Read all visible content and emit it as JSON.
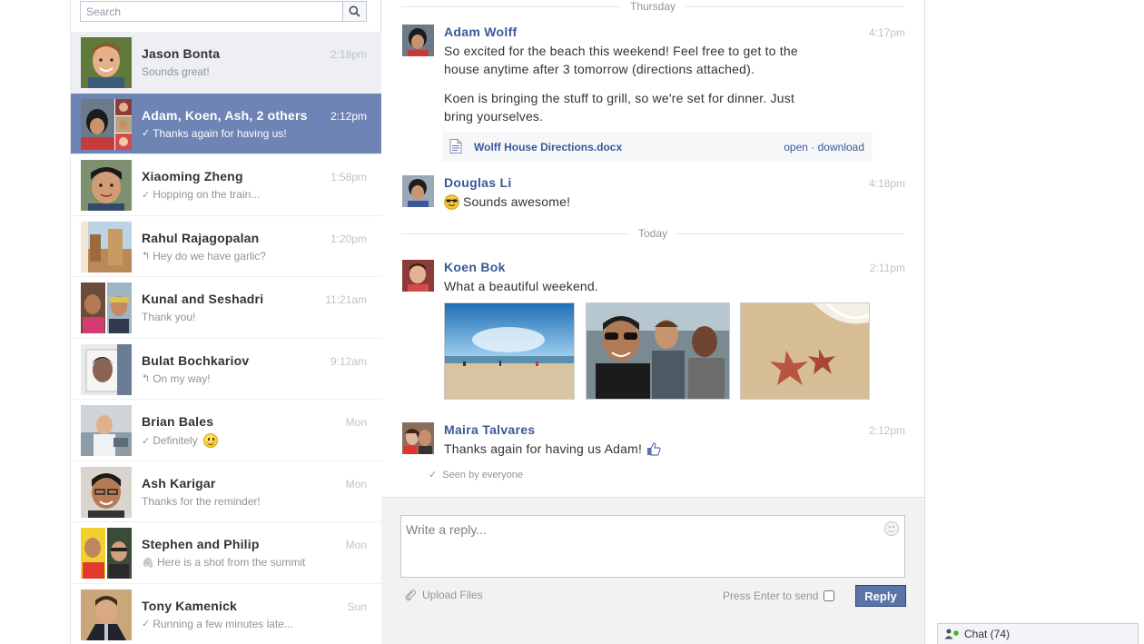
{
  "search": {
    "placeholder": "Search"
  },
  "threads": [
    {
      "name": "Jason Bonta",
      "time": "2:18pm",
      "snippet": "Sounds great!",
      "mark": ""
    },
    {
      "name": "Adam, Koen, Ash, 2 others",
      "time": "2:12pm",
      "snippet": "Thanks again for having us!",
      "mark": "✓"
    },
    {
      "name": "Xiaoming Zheng",
      "time": "1:58pm",
      "snippet": "Hopping on the train...",
      "mark": "✓"
    },
    {
      "name": "Rahul Rajagopalan",
      "time": "1:20pm",
      "snippet": "Hey do we have garlic?",
      "mark": "↰"
    },
    {
      "name": "Kunal and Seshadri",
      "time": "11:21am",
      "snippet": "Thank you!",
      "mark": ""
    },
    {
      "name": "Bulat Bochkariov",
      "time": "9:12am",
      "snippet": "On my way!",
      "mark": "↰"
    },
    {
      "name": "Brian Bales",
      "time": "Mon",
      "snippet": "Definitely",
      "mark": "✓"
    },
    {
      "name": "Ash Karigar",
      "time": "Mon",
      "snippet": "Thanks for the reminder!",
      "mark": ""
    },
    {
      "name": "Stephen and Philip",
      "time": "Mon",
      "snippet": "Here is a shot from the summit",
      "mark": "⌕"
    },
    {
      "name": "Tony Kamenick",
      "time": "Sun",
      "snippet": "Running a few minutes late...",
      "mark": "✓"
    }
  ],
  "conversation": {
    "divider_thursday": "Thursday",
    "divider_today": "Today",
    "messages": [
      {
        "name": "Adam Wolff",
        "time": "4:17pm",
        "text1": "So excited for the beach this weekend! Feel free to get to the",
        "text2": "house anytime after 3 tomorrow (directions attached).",
        "text3": "Koen is bringing the stuff to grill, so we're set for dinner. Just",
        "text4": "bring yourselves."
      },
      {
        "name": "Douglas Li",
        "time": "4:18pm",
        "text1": "Sounds awesome!"
      },
      {
        "name": "Koen Bok",
        "time": "2:11pm",
        "text1": "What a beautiful weekend."
      },
      {
        "name": "Maira Talvares",
        "time": "2:12pm",
        "text1": "Thanks again for having us Adam!"
      }
    ],
    "attachment": {
      "filename": "Wolff House Directions.docx",
      "open": "open",
      "separator": " · ",
      "download": "download"
    },
    "seen": "Seen by everyone"
  },
  "composer": {
    "placeholder": "Write a reply...",
    "upload_label": "Upload Files",
    "enter_label": "Press Enter to send",
    "reply_label": "Reply"
  },
  "chat_bar": {
    "label": "Chat (74)"
  },
  "colors": {
    "brand_blue": "#3b5998",
    "selected_row": "#6d84b4",
    "reply_button": "#5b74a8"
  }
}
